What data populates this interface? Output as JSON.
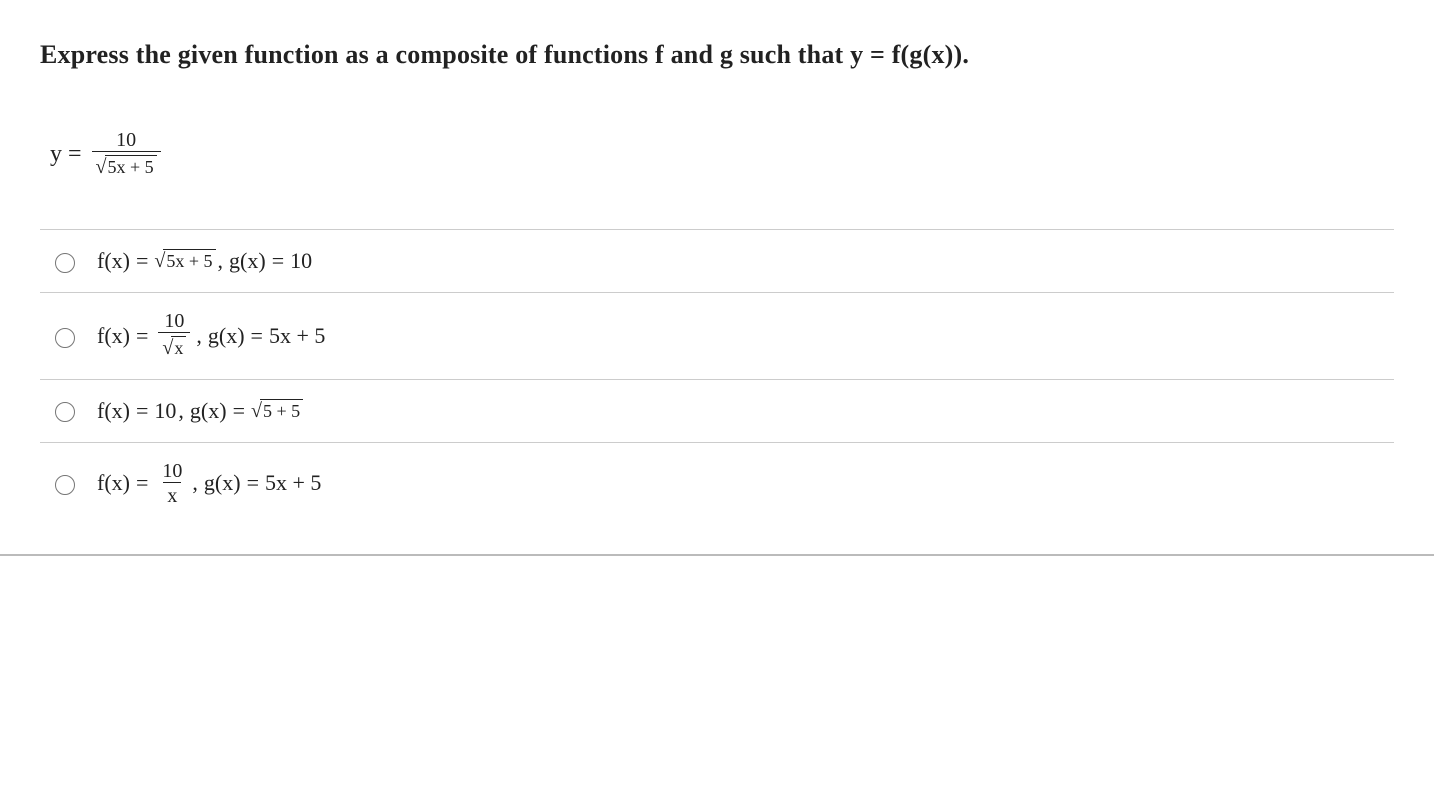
{
  "question": {
    "prompt": "Express the given function as a composite of functions f and g such that y = f(g(x))."
  },
  "given": {
    "lhs": "y",
    "equals": "=",
    "numerator": "10",
    "radicand": "5x + 5"
  },
  "labels": {
    "fx": "f(x)",
    "gx": "g(x)",
    "equals": "=",
    "comma": ",",
    "sqrt_symbol": "√"
  },
  "options": [
    {
      "id": "a",
      "f_type": "sqrt",
      "f_radicand": "5x + 5",
      "g_text": "10"
    },
    {
      "id": "b",
      "f_type": "frac_sqrt",
      "f_numerator": "10",
      "f_den_radicand": "x",
      "g_text": "5x + 5"
    },
    {
      "id": "c",
      "f_type": "plain",
      "f_text": "10",
      "g_type": "sqrt",
      "g_radicand": "5 + 5"
    },
    {
      "id": "d",
      "f_type": "frac",
      "f_numerator": "10",
      "f_denominator": "x",
      "g_text": "5x + 5"
    }
  ]
}
